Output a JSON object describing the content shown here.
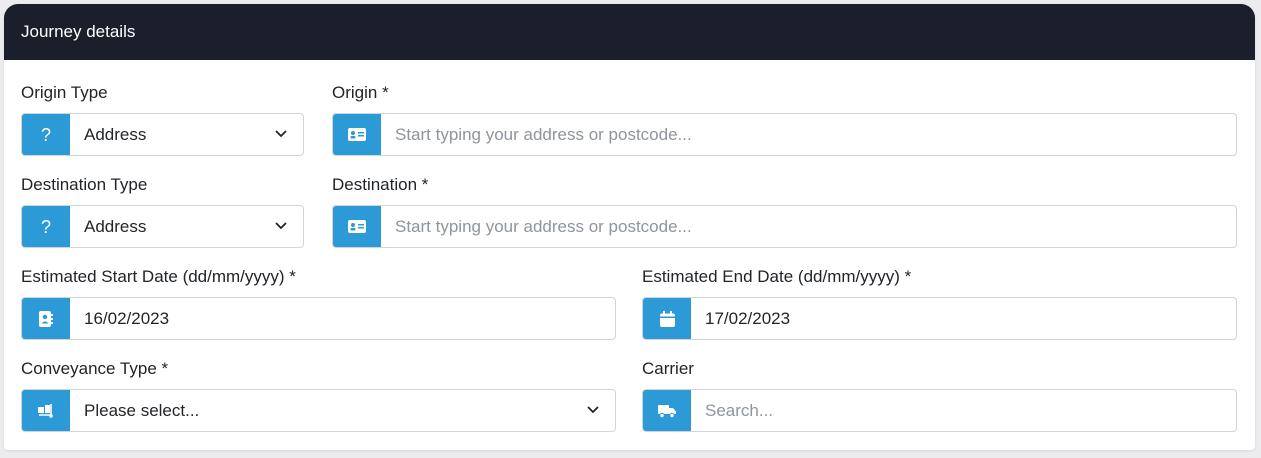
{
  "panel": {
    "title": "Journey details"
  },
  "origin_type": {
    "label": "Origin Type",
    "value": "Address",
    "icon": "question-icon"
  },
  "origin": {
    "label": "Origin *",
    "placeholder": "Start typing your address or postcode...",
    "icon": "address-card-icon"
  },
  "destination_type": {
    "label": "Destination Type",
    "value": "Address",
    "icon": "question-icon"
  },
  "destination": {
    "label": "Destination *",
    "placeholder": "Start typing your address or postcode...",
    "icon": "address-card-icon"
  },
  "start_date": {
    "label": "Estimated Start Date (dd/mm/yyyy) *",
    "value": "16/02/2023",
    "icon": "contact-book-icon"
  },
  "end_date": {
    "label": "Estimated End Date (dd/mm/yyyy) *",
    "value": "17/02/2023",
    "icon": "calendar-icon"
  },
  "conveyance_type": {
    "label": "Conveyance Type *",
    "value": "Please select...",
    "icon": "dolly-icon"
  },
  "carrier": {
    "label": "Carrier",
    "placeholder": "Search...",
    "icon": "truck-icon"
  },
  "colors": {
    "header_bg": "#1b1e2b",
    "accent": "#2b9ad6"
  }
}
